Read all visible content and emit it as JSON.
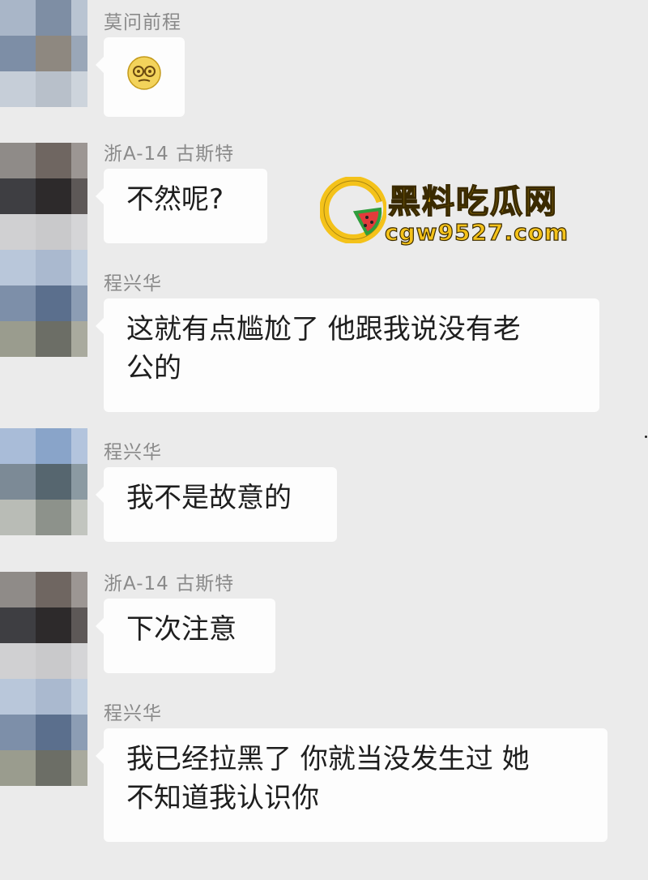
{
  "messages": [
    {
      "sender": "莫问前程",
      "lines": [],
      "emoji": "face-with-glasses-emoji"
    },
    {
      "sender": "浙A-14 古斯特",
      "lines": [
        "不然呢?"
      ]
    },
    {
      "sender": "程兴华",
      "lines": [
        "这就有点尴尬了 他跟我说没有老",
        "公的"
      ]
    },
    {
      "sender": "程兴华",
      "lines": [
        "我不是故意的"
      ]
    },
    {
      "sender": "浙A-14 古斯特",
      "lines": [
        "下次注意"
      ]
    },
    {
      "sender": "程兴华",
      "lines": [
        "我已经拉黑了 你就当没发生过 她",
        "不知道我认识你"
      ]
    }
  ],
  "watermark": {
    "title": "黑料吃瓜网",
    "url": "cgw9527.com",
    "icon": "watermelon-logo-icon"
  },
  "colors": {
    "background": "#ebebeb",
    "bubble": "#fdfdfd",
    "sender": "#8a8a8a",
    "watermark": "#f4c21a"
  }
}
